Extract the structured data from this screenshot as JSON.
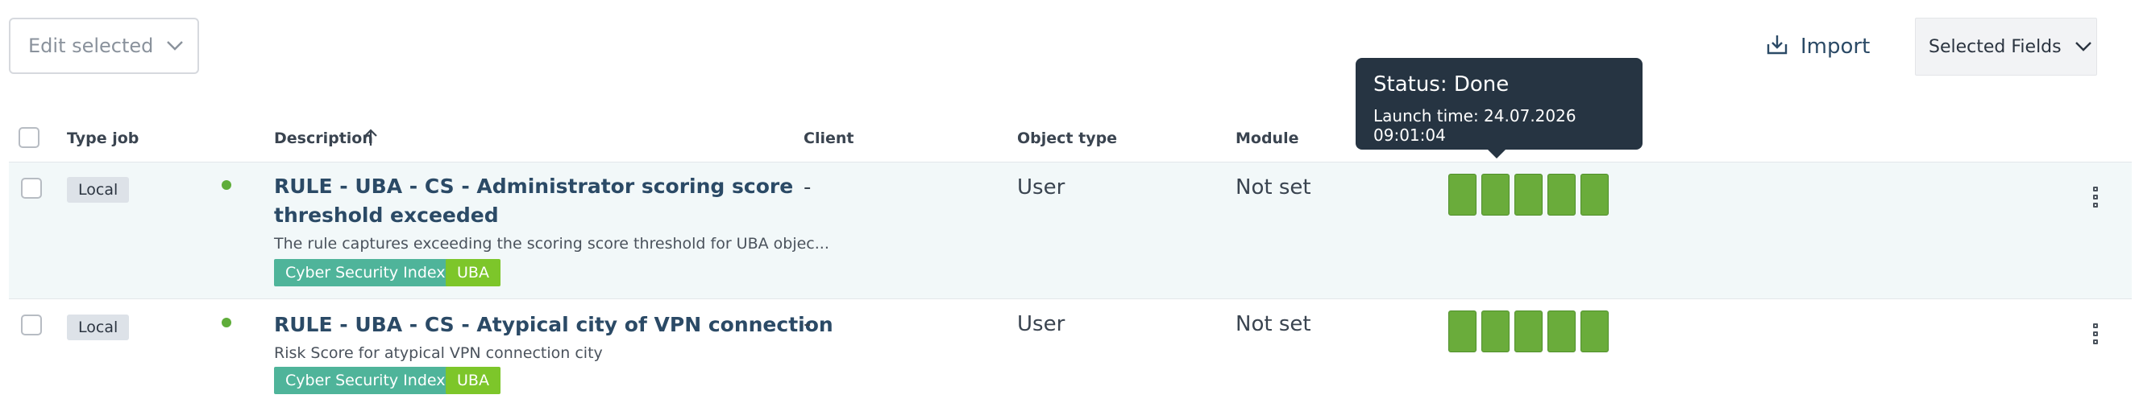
{
  "toolbar": {
    "edit_selected_label": "Edit selected",
    "import_label": "Import",
    "selected_fields_label": "Selected Fields"
  },
  "table": {
    "columns": {
      "type_job": "Type job",
      "description": "Description",
      "client": "Client",
      "object_type": "Object type",
      "module": "Module"
    },
    "rows": [
      {
        "type_job": "Local",
        "title_line1": "RULE - UBA - CS - Administrator scoring score",
        "title_line2": "threshold exceeded",
        "description": "The rule captures exceeding the scoring score threshold for UBA objec...",
        "tags": [
          "Cyber Security Index",
          "UBA"
        ],
        "client": "-",
        "object_type": "User",
        "module": "Not set",
        "status_bars": 5
      },
      {
        "type_job": "Local",
        "title_line1": "RULE - UBA - CS - Atypical city of VPN connection",
        "description": "Risk Score for atypical VPN connection city",
        "tags": [
          "Cyber Security Index",
          "UBA"
        ],
        "client": "-",
        "object_type": "User",
        "module": "Not set",
        "status_bars": 5
      }
    ]
  },
  "tooltip": {
    "status": "Status: Done",
    "launch_time": "Launch time: 24.07.2026 09:01:04"
  },
  "colors": {
    "accent_title": "#2b4a66",
    "status_done": "#6aac3b",
    "tag_csi": "#4fb49a",
    "tag_uba": "#7dc62a",
    "tooltip_bg": "#263442"
  },
  "icons": {
    "edit_chevron": "chevron-down-icon",
    "import": "import-icon",
    "fields_chevron": "chevron-down-icon",
    "sort": "arrow-up-icon",
    "row_menu": "kebab-menu-icon"
  }
}
